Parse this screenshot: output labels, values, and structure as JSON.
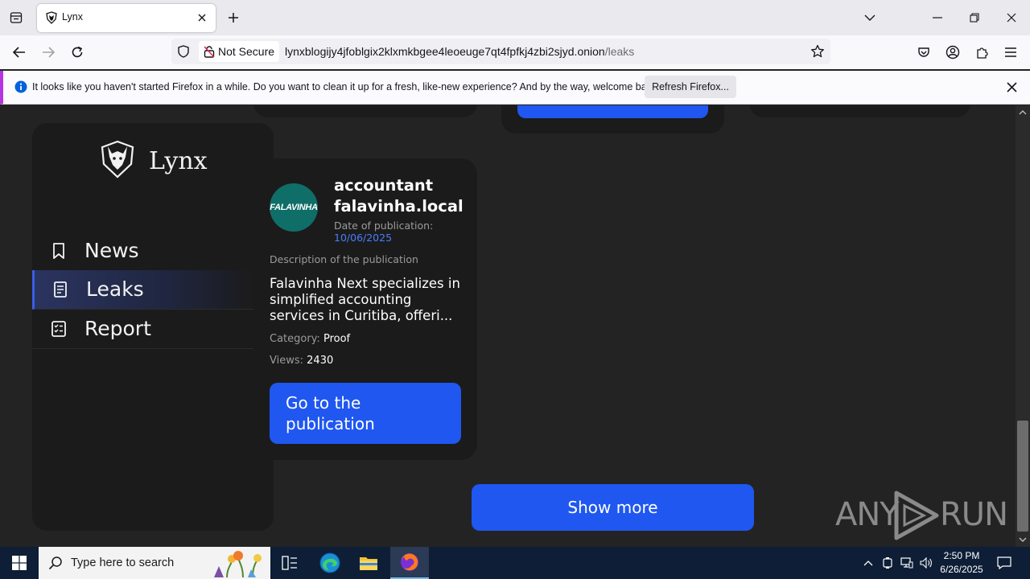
{
  "browser": {
    "tab_title": "Lynx",
    "not_secure_label": "Not Secure",
    "url_host": "lynxblogijy4jfoblgix2klxmkbgee4leoeuge7qt4fpfkj4zbi2sjyd.onion",
    "url_path": "/leaks"
  },
  "notification": {
    "message": "It looks like you haven't started Firefox in a while. Do you want to clean it up for a fresh, like-new experience? And by the way, welcome back!",
    "button_label": "Refresh Firefox..."
  },
  "site": {
    "logo_name": "Lynx",
    "menu": [
      {
        "label": "News",
        "icon": "bookmark-icon"
      },
      {
        "label": "Leaks",
        "icon": "document-icon",
        "active": true
      },
      {
        "label": "Report",
        "icon": "checklist-icon"
      }
    ]
  },
  "card": {
    "logo_text": "FALAVINHA",
    "title": "accountant falavinha.local",
    "date_label": "Date of publication:",
    "date_value": "10/06/2025",
    "description_label": "Description of the publication",
    "description": "Falavinha Next specializes in simplified accounting services in Curitiba, offeri...",
    "category_label": "Category:",
    "category_value": "Proof",
    "views_label": "Views:",
    "views_value": "2430",
    "button_label": "Go to the publication"
  },
  "show_more_label": "Show more",
  "watermark": {
    "left": "ANY",
    "right": "RUN"
  },
  "taskbar": {
    "search_placeholder": "Type here to search",
    "time": "2:50 PM",
    "date": "6/26/2025"
  },
  "colors": {
    "accent_blue": "#1f57f0",
    "date_blue": "#4a7dff",
    "page_bg": "#232323",
    "card_bg": "#1b1b1b",
    "notification_accent": "#b833e1"
  }
}
